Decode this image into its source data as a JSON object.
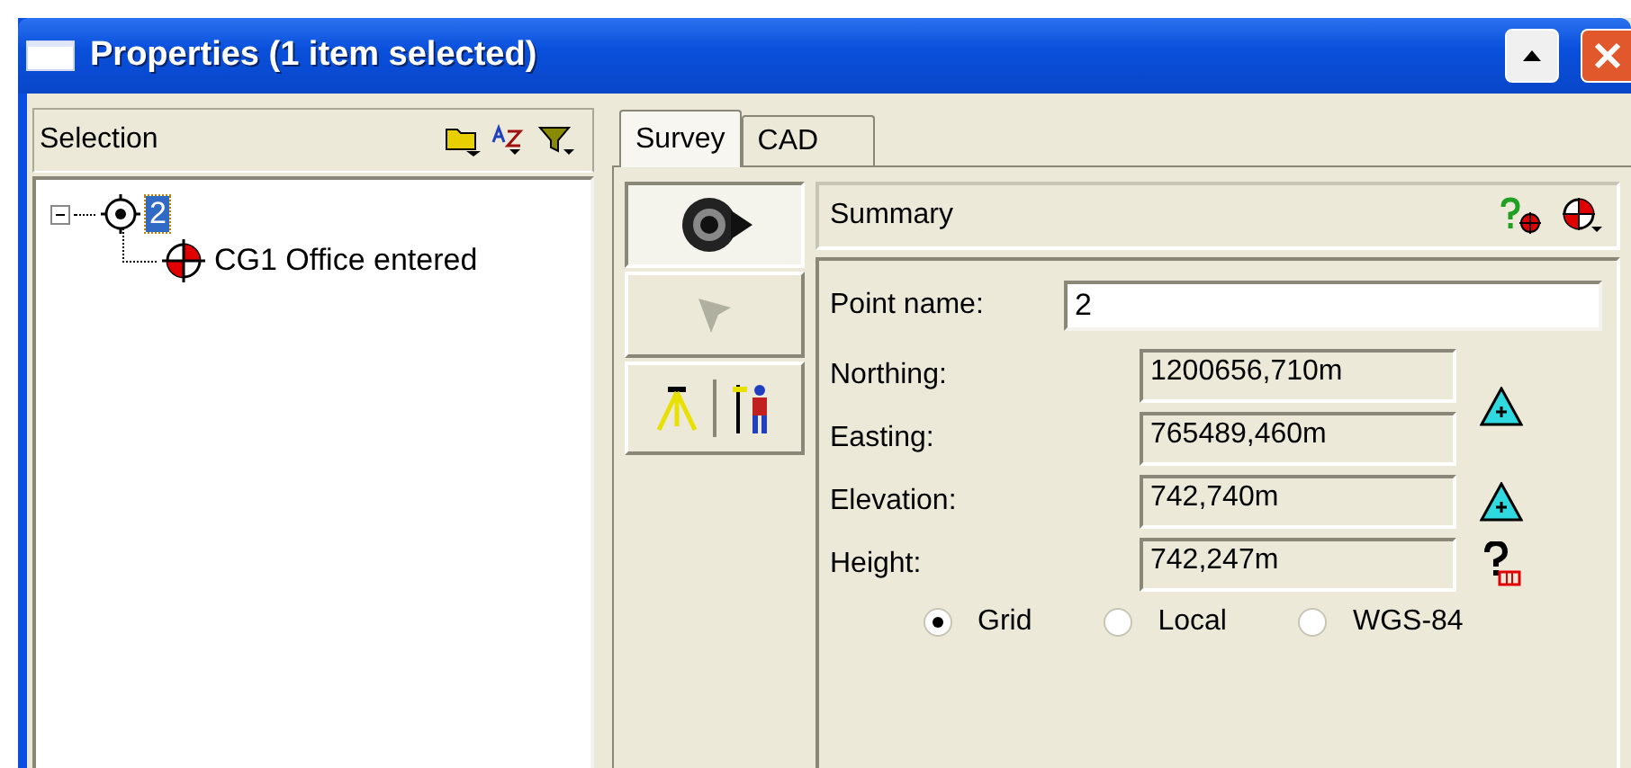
{
  "window": {
    "title": "Properties (1 item selected)"
  },
  "selection_panel": {
    "title": "Selection",
    "tree": [
      {
        "label": "2",
        "selected": true,
        "expanded": true,
        "children": [
          {
            "label": "CG1 Office entered",
            "selected": false
          }
        ]
      }
    ]
  },
  "tabs": [
    {
      "label": "Survey",
      "selected": true
    },
    {
      "label": "CAD",
      "selected": false
    }
  ],
  "side_buttons": [
    {
      "kind": "instrument",
      "pressed": true
    },
    {
      "kind": "flag",
      "pressed": false
    },
    {
      "kind": "tools",
      "pressed": false
    }
  ],
  "summary": {
    "title": "Summary"
  },
  "point_name": {
    "label": "Point name:",
    "value": "2"
  },
  "coordinate_groups": [
    {
      "kind": "triangle",
      "fields": [
        {
          "label": "Northing:",
          "value": "1200656,710m"
        },
        {
          "label": "Easting:",
          "value": "765489,460m"
        }
      ]
    },
    {
      "kind": "triangle",
      "fields": [
        {
          "label": "Elevation:",
          "value": "742,740m"
        }
      ]
    },
    {
      "kind": "question",
      "fields": [
        {
          "label": "Height:",
          "value": "742,247m"
        }
      ]
    }
  ],
  "coordinate_systems": [
    {
      "label": "Grid",
      "selected": true
    },
    {
      "label": "Local",
      "selected": false
    },
    {
      "label": "WGS-84",
      "selected": false
    }
  ]
}
